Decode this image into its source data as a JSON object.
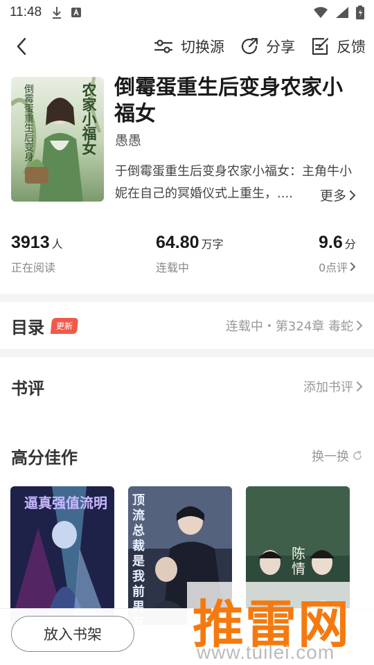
{
  "status_bar": {
    "time": "11:48"
  },
  "top_bar": {
    "switch_source_label": "切换源",
    "share_label": "分享",
    "feedback_label": "反馈"
  },
  "book": {
    "title": "倒霉蛋重生后变身农家小福女",
    "author": "愚愚",
    "description": "于倒霉蛋重生后变身农家小福女：主角牛小妮在自己的冥婚仪式上重生，....",
    "more_label": "更多",
    "cover_text_left": "倒霉蛋重生后变身",
    "cover_text_right": "农家小福女"
  },
  "stats": {
    "readers": {
      "value": "3913",
      "unit": "人",
      "label": "正在阅读"
    },
    "words": {
      "value": "64.80",
      "unit": "万字",
      "label": "连载中"
    },
    "score": {
      "value": "9.6",
      "unit": "分",
      "label": "0点评"
    }
  },
  "catalog": {
    "title": "目录",
    "badge": "更新",
    "status": "连载中・第324章 毒蛇"
  },
  "reviews": {
    "title": "书评",
    "action": "添加书评"
  },
  "recommend": {
    "title": "高分佳作",
    "action": "换一换",
    "books": [
      {
        "cover_text": "逼真强值流明"
      },
      {
        "cover_text": "顶流总裁是我前男友"
      },
      {
        "cover_text": "陈情"
      }
    ]
  },
  "bottom": {
    "shelf_button": "放入书架"
  },
  "watermark": {
    "text": "推雷网",
    "url": "www.tuilei.com"
  },
  "colors": {
    "badge": "#f05a4a",
    "watermark": "#f47a10"
  }
}
